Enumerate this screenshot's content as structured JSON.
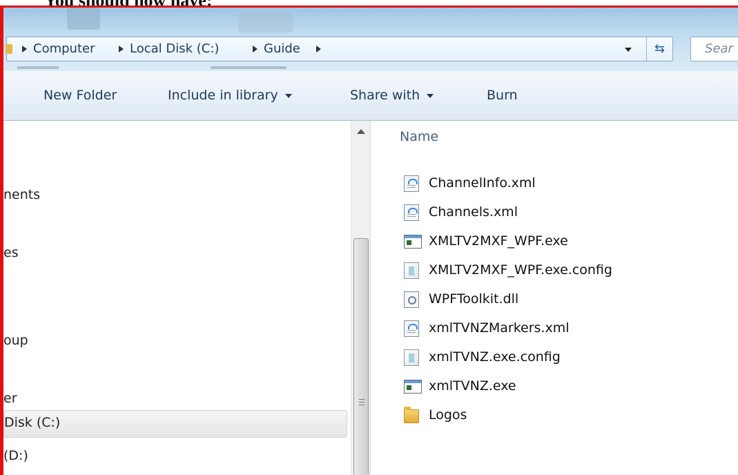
{
  "caption": "You should now have:",
  "address": {
    "crumbs": [
      "Computer",
      "Local Disk (C:)",
      "Guide"
    ],
    "search_placeholder": "Sear"
  },
  "toolbar": {
    "new_folder": "New Folder",
    "include_in_library": "Include in library",
    "share_with": "Share with",
    "burn": "Burn"
  },
  "nav": {
    "items": [
      "nents",
      "es",
      "oup",
      "er",
      "Disk (C:)",
      "(D:)"
    ]
  },
  "content": {
    "column_name": "Name",
    "files": [
      {
        "name": "ChannelInfo.xml",
        "icon": "xml-file-icon"
      },
      {
        "name": "Channels.xml",
        "icon": "xml-file-icon"
      },
      {
        "name": "XMLTV2MXF_WPF.exe",
        "icon": "exe-file-icon"
      },
      {
        "name": "XMLTV2MXF_WPF.exe.config",
        "icon": "config-file-icon"
      },
      {
        "name": "WPFToolkit.dll",
        "icon": "dll-file-icon"
      },
      {
        "name": "xmlTVNZMarkers.xml",
        "icon": "xml-file-icon"
      },
      {
        "name": "xmlTVNZ.exe.config",
        "icon": "config-file-icon"
      },
      {
        "name": "xmlTVNZ.exe",
        "icon": "exe-file-icon"
      },
      {
        "name": "Logos",
        "icon": "folder-icon"
      }
    ]
  },
  "colors": {
    "highlight_border": "#e01010",
    "title_bar": "#bcd9ef",
    "toolbar_text": "#1e395b"
  }
}
